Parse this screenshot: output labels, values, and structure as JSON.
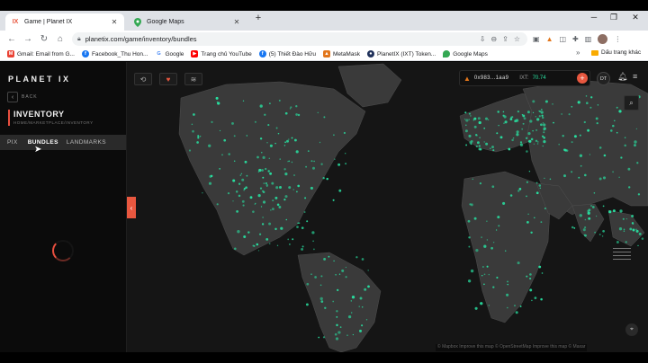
{
  "browser": {
    "tabs": [
      {
        "title": "Game | Planet IX",
        "icon": "ix-logo-icon",
        "active": true
      },
      {
        "title": "Google Maps",
        "icon": "google-maps-icon",
        "active": false
      }
    ],
    "url": "planetix.com/game/inventory/bundles",
    "bookmarks": [
      {
        "label": "Gmail: Email from G...",
        "icon": "gmail-icon",
        "color": "#ea4335"
      },
      {
        "label": "Facebook_Thu Hon...",
        "icon": "facebook-icon",
        "color": "#1877f2"
      },
      {
        "label": "Google",
        "icon": "google-icon",
        "color": "#4285f4"
      },
      {
        "label": "Trang chủ YouTube",
        "icon": "youtube-icon",
        "color": "#ff0000"
      },
      {
        "label": "(5) Thiết Đào Hữu",
        "icon": "facebook-icon",
        "color": "#1877f2"
      },
      {
        "label": "MetaMask",
        "icon": "metamask-icon",
        "color": "#e2761b"
      },
      {
        "label": "PlanetIX (IXT) Token...",
        "icon": "etherscan-icon",
        "color": "#21325b"
      },
      {
        "label": "Google Maps",
        "icon": "google-maps-icon",
        "color": "#34a853"
      }
    ],
    "other_bookmarks": "Dấu trang khác"
  },
  "app": {
    "logo": "PLANET IX",
    "back_label": "BACK",
    "inventory_title": "INVENTORY",
    "breadcrumb": "HOME/MARKETPLACE/INVENTORY",
    "subtabs": [
      {
        "label": "PIX",
        "active": false
      },
      {
        "label": "BUNDLES",
        "active": true
      },
      {
        "label": "LANDMARKS",
        "active": false
      }
    ],
    "wallet": {
      "address": "0x983...1aa9",
      "ixt_label": "IXT:",
      "ixt_value": "70.74"
    },
    "user_initials": "DT",
    "attribution": "© Mapbox  Improve this map  © OpenStreetMap  Improve this map  © Maxar",
    "accent_color": "#e8573f",
    "pix_color": "#28e0a0"
  }
}
